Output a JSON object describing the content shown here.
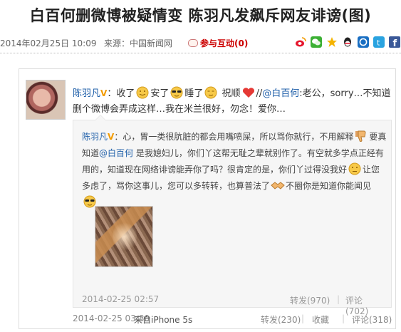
{
  "article": {
    "title": "白百何删微博被疑情变 陈羽凡发飙斥网友诽谤(图)",
    "date": "2014年02月25日 10:09",
    "source": "来源：中国新闻网",
    "comment_link": "参与互动(0)"
  },
  "share_icons": [
    {
      "name": "weibo-share-icon",
      "color": "#e6162d"
    },
    {
      "name": "wechat-share-icon",
      "color": "#3cb034"
    },
    {
      "name": "qzone-share-icon",
      "color": "#f5b400"
    },
    {
      "name": "qq-share-icon",
      "color": "#222222"
    },
    {
      "name": "renren-share-icon",
      "color": "#1a6fc3"
    },
    {
      "name": "tencent-weibo-share-icon",
      "color": "#2aa3e0"
    },
    {
      "name": "facebook-share-icon",
      "color": "#3b5998"
    }
  ],
  "post": {
    "user": "陈羽凡",
    "badge": "V",
    "text_1": "：收了",
    "text_2": "安了",
    "text_3": "睡了",
    "text_4": " 祝顺",
    "text_5": "//",
    "mention": "@白百何",
    "text_6": ":老公，sorry…不知道删个微博会弄成这样…我在米兰很好，勿念！爱你…",
    "time": "2014-02-25 03:30",
    "from_prefix": "来自",
    "device": "iPhone 5s",
    "repost": "转发(230)",
    "favorite": "收藏",
    "comment": "评论(318)",
    "separator": "|"
  },
  "quote": {
    "user": "陈羽凡",
    "badge": "V",
    "text_1": "：心，胃一类很肮脏的都会用嘴喷屎，所以骂你就行，不用解释",
    "text_2": "要真知道",
    "mention": "@白百何",
    "text_3": " 是我媳妇儿，你们丫这帮无耻之辈就别作了。有空就多学点正经有用的，知道现在网络诽谤能弄你了吗？很肯定的是，你们丫过得没我好",
    "text_4": "让您多虑了，骂你这事儿，您可以多转转，也算普法了",
    "text_5": "不圈你是知道你能闻见",
    "time": "2014-02-25 02:57",
    "repost": "转发(970)",
    "comment": "评论(702)",
    "separator": "|"
  },
  "colors": {
    "link_blue": "#1f5fa9",
    "badge_orange": "#f29b00",
    "comment_red": "#cc0000"
  }
}
